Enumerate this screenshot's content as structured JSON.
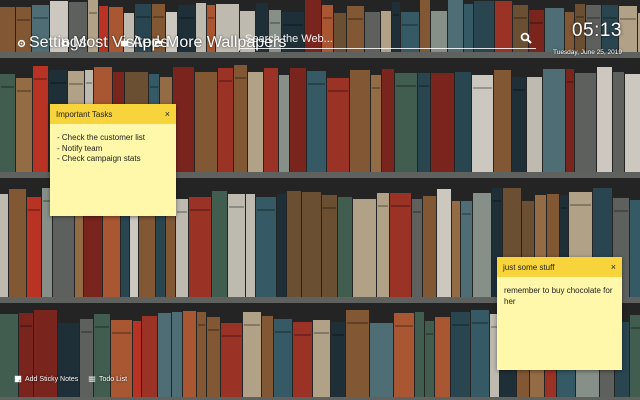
{
  "topbar": {
    "settings_label": "Settings",
    "most_visited_label": "Most Visited",
    "apps_label": "Apps",
    "more_wallpapers_label": "More Wallpapers"
  },
  "search": {
    "placeholder": "Search the Web..."
  },
  "clock": {
    "time": "05:13",
    "date": "Tuesday, June 25, 2019"
  },
  "notes": [
    {
      "title": "Important Tasks",
      "close": "×",
      "body": "- Check the customer list\n- Notify team\n- Check campaign stats"
    },
    {
      "title": "just some stuff",
      "close": "×",
      "body": "remember to buy chocolate for her"
    }
  ],
  "bottom": {
    "add_sticky_label": "Add Sticky Notes",
    "todo_label": "Todo List"
  },
  "colors": {
    "note_header": "#f7d43c",
    "note_body": "#fff7aa"
  },
  "icons": [
    "gear-icon",
    "eye-icon",
    "apps-icon",
    "image-icon",
    "search-icon",
    "sticky-note-icon",
    "list-icon"
  ]
}
